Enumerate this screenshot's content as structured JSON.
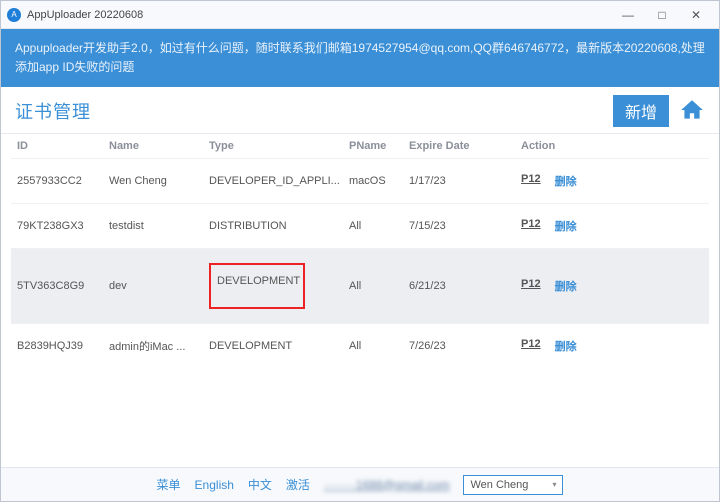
{
  "window": {
    "title": "AppUploader 20220608",
    "minimize": "—",
    "maximize": "□",
    "close": "✕"
  },
  "banner": "Appuploader开发助手2.0，如过有什么问题，随时联系我们邮箱1974527954@qq.com,QQ群646746772，最新版本20220608,处理添加app ID失败的问题",
  "header": {
    "title": "证书管理",
    "add_button": "新增"
  },
  "table": {
    "headers": {
      "id": "ID",
      "name": "Name",
      "type": "Type",
      "pname": "PName",
      "expire": "Expire Date",
      "action": "Action"
    },
    "actions": {
      "p12": "P12",
      "delete": "删除"
    },
    "rows": [
      {
        "id": "2557933CC2",
        "name": "Wen Cheng",
        "type": "DEVELOPER_ID_APPLI...",
        "pname": "macOS",
        "expire": "1/17/23",
        "highlight": false
      },
      {
        "id": "79KT238GX3",
        "name": "testdist",
        "type": "DISTRIBUTION",
        "pname": "All",
        "expire": "7/15/23",
        "highlight": false
      },
      {
        "id": "5TV363C8G9",
        "name": "dev",
        "type": "DEVELOPMENT",
        "pname": "All",
        "expire": "6/21/23",
        "highlight": true
      },
      {
        "id": "B2839HQJ39",
        "name": "admin的iMac ...",
        "type": "DEVELOPMENT",
        "pname": "All",
        "expire": "7/26/23",
        "highlight": false
      }
    ]
  },
  "footer": {
    "menu": "菜单",
    "english": "English",
    "chinese": "中文",
    "activate": "激活",
    "email_masked": "········1688@gmail.com",
    "user": "Wen Cheng"
  }
}
